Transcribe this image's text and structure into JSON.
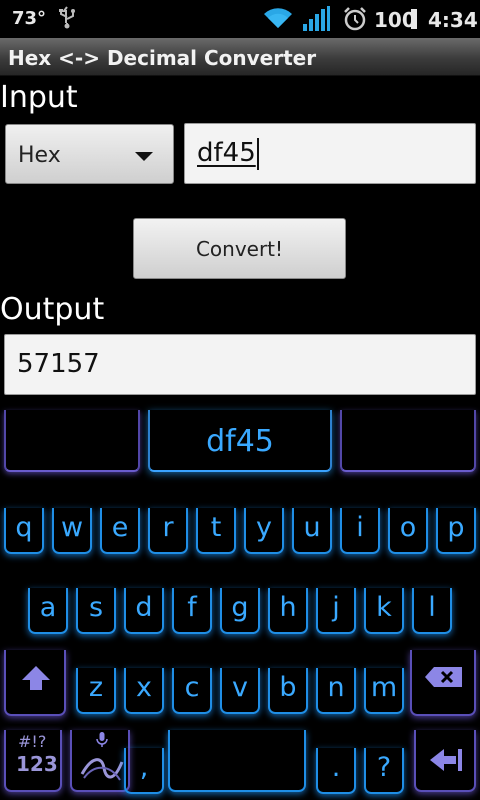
{
  "status_bar": {
    "temperature": "73°",
    "battery_level": "100",
    "time": "4:34",
    "icons": [
      "usb-icon",
      "wifi-icon",
      "signal-icon",
      "alarm-icon",
      "battery-icon"
    ]
  },
  "app": {
    "title": "Hex <-> Decimal Converter"
  },
  "input": {
    "label": "Input",
    "type_selected": "Hex",
    "value": "df45"
  },
  "convert_label": "Convert!",
  "output": {
    "label": "Output",
    "value": "57157"
  },
  "keyboard": {
    "candidate": "df45",
    "number_hints": [
      "1",
      "2",
      "3",
      "4",
      "5",
      "6",
      "7",
      "8",
      "9",
      "0"
    ],
    "row1": [
      "q",
      "w",
      "e",
      "r",
      "t",
      "y",
      "u",
      "i",
      "o",
      "p"
    ],
    "row2_hints": [
      "@",
      "#",
      "%",
      "&",
      "*",
      "-",
      "+",
      "=",
      "/"
    ],
    "row2": [
      "a",
      "s",
      "d",
      "f",
      "g",
      "h",
      "j",
      "k",
      "l"
    ],
    "row3_hints": [
      "_",
      "$",
      "^",
      "\"",
      "'",
      ":",
      ";"
    ],
    "row3": [
      "z",
      "x",
      "c",
      "v",
      "b",
      "n",
      "m"
    ],
    "symbols_hint": "#!?",
    "symbols_label": "123",
    "row4_hints": [
      "(",
      ")",
      "!"
    ],
    "row4": [
      ",",
      ".",
      "?"
    ],
    "accent_color": "#3aa9ff",
    "modifier_color": "#6a5ccc"
  }
}
